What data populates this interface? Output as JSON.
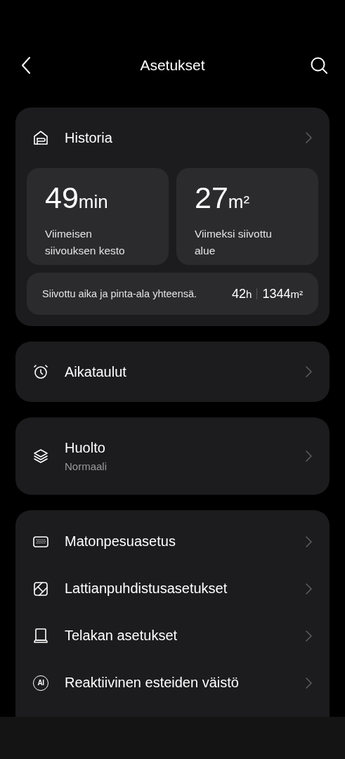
{
  "header": {
    "title": "Asetukset"
  },
  "history": {
    "kind": "history",
    "title": "Historia",
    "stats": [
      {
        "value": "49",
        "unit": "min",
        "label": "Viimeisen siivouksen kesto"
      },
      {
        "value": "27",
        "unit": "m²",
        "label": "Viimeksi siivottu alue"
      }
    ],
    "total": {
      "label": "Siivottu aika ja pinta-ala yhteensä.",
      "hours_value": "42",
      "hours_unit": "h",
      "area_value": "1344",
      "area_unit": "m²"
    }
  },
  "cards": [
    {
      "items": [
        {
          "kind": "alarm",
          "title": "Aikataulut"
        }
      ]
    },
    {
      "items": [
        {
          "kind": "layers",
          "title": "Huolto",
          "subtitle": "Normaali"
        }
      ]
    },
    {
      "items": [
        {
          "kind": "carpet",
          "title": "Matonpesuasetus"
        },
        {
          "kind": "floor",
          "title": "Lattianpuhdistusasetukset"
        },
        {
          "kind": "dock",
          "title": "Telakan asetukset"
        },
        {
          "kind": "ai",
          "badge": "AI",
          "title": "Reaktiivinen esteiden väistö"
        }
      ]
    }
  ]
}
